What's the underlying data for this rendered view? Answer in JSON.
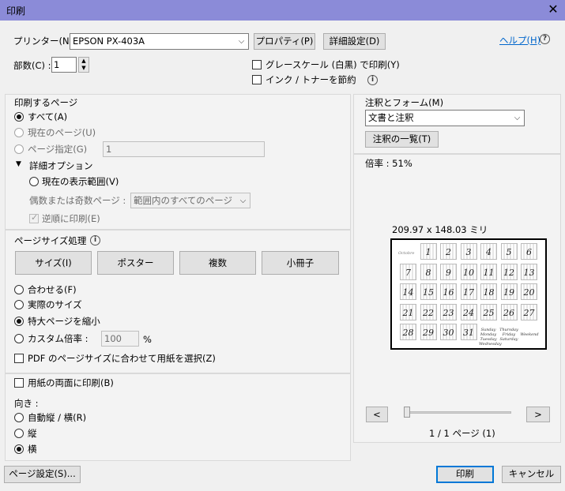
{
  "window": {
    "title": "印刷",
    "close": "✕"
  },
  "printer": {
    "label": "プリンター(N) :",
    "selected": "EPSON PX-403A",
    "properties_button": "プロパティ(P)",
    "advanced_button": "詳細設定(D)",
    "help_link": "ヘルプ(H)"
  },
  "copies": {
    "label": "部数(C) :",
    "value": "1"
  },
  "options": {
    "grayscale": "グレースケール (白黒) で印刷(Y)",
    "save_ink": "インク / トナーを節約"
  },
  "pages_to_print": {
    "heading": "印刷するページ",
    "all": "すべて(A)",
    "current": "現在のページ(U)",
    "range": "ページ指定(G)",
    "range_value": "1",
    "more_options": "詳細オプション",
    "current_view": "現在の表示範囲(V)",
    "odd_even_label": "偶数または奇数ページ :",
    "odd_even_value": "範囲内のすべてのページ",
    "reverse": "逆順に印刷(E)"
  },
  "page_sizing": {
    "heading": "ページサイズ処理",
    "buttons": [
      "サイズ(I)",
      "ポスター",
      "複数",
      "小冊子"
    ],
    "fit": "合わせる(F)",
    "actual": "実際のサイズ",
    "shrink": "特大ページを縮小",
    "custom": "カスタム倍率 :",
    "custom_value": "100",
    "percent": "%",
    "pdf_paper": "PDF のページサイズに合わせて用紙を選択(Z)"
  },
  "duplex": {
    "label": "用紙の両面に印刷(B)"
  },
  "orientation": {
    "heading": "向き :",
    "auto": "自動縦 / 横(R)",
    "portrait": "縦",
    "landscape": "横"
  },
  "comments": {
    "heading": "注釈とフォーム(M)",
    "selected": "文書と注釈",
    "summary_button": "注釈の一覧(T)"
  },
  "preview": {
    "scale": "倍率 : 51%",
    "dimensions": "209.97 x 148.03 ミリ",
    "calendar_header": "Octobre",
    "rows": [
      [
        "",
        "1",
        "2",
        "3",
        "4",
        "5",
        "6"
      ],
      [
        "7",
        "8",
        "9",
        "10",
        "11",
        "12",
        "13"
      ],
      [
        "14",
        "15",
        "16",
        "17",
        "18",
        "19",
        "20"
      ],
      [
        "21",
        "22",
        "23",
        "24",
        "25",
        "26",
        "27"
      ],
      [
        "28",
        "29",
        "30",
        "31",
        "",
        "",
        ""
      ]
    ],
    "weekday_notes": [
      "Sunday Monday Tuesday Wednesday",
      "Thursday Friday Saturday",
      "Weekend"
    ],
    "prev": "<",
    "next": ">",
    "page_indicator": "1 / 1 ページ (1)"
  },
  "footer": {
    "page_setup": "ページ設定(S)...",
    "print": "印刷",
    "cancel": "キャンセル"
  }
}
